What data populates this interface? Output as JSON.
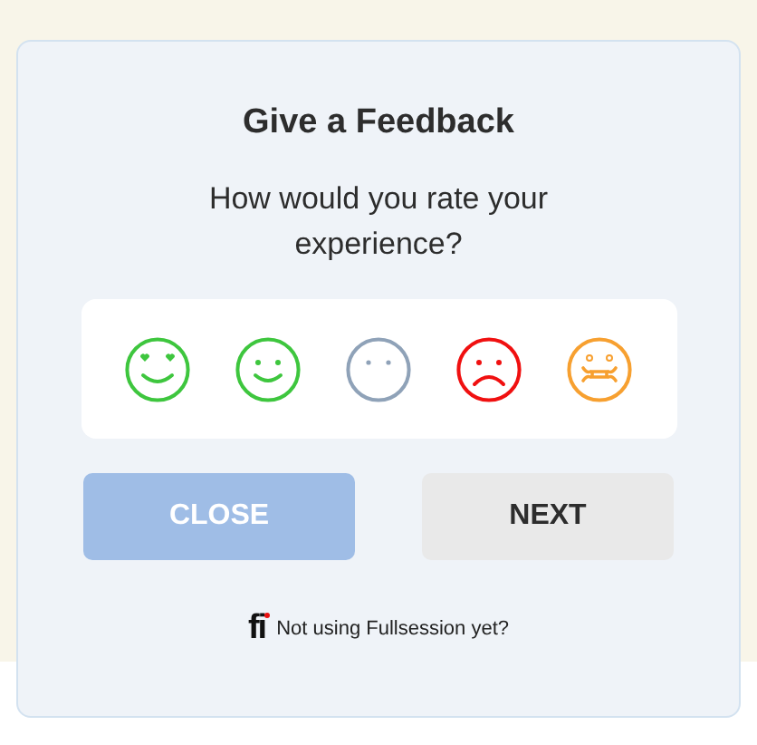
{
  "dialog": {
    "title": "Give a Feedback",
    "question": "How would you rate your experience?"
  },
  "ratings": [
    {
      "kind": "love",
      "color": "#3ec63e",
      "selected": false
    },
    {
      "kind": "smile",
      "color": "#3ec63e",
      "selected": false
    },
    {
      "kind": "neutral",
      "color": "#8fa2b8",
      "selected": false
    },
    {
      "kind": "sad",
      "color": "#f01010",
      "selected": false
    },
    {
      "kind": "sick",
      "color": "#f7a030",
      "selected": false
    }
  ],
  "buttons": [
    {
      "label": "CLOSE",
      "kind": "secondary",
      "disabled": true
    },
    {
      "label": "NEXT",
      "kind": "primary",
      "disabled": false
    }
  ],
  "footer": {
    "logo": "fi",
    "text": "Not using Fullsession yet?"
  }
}
